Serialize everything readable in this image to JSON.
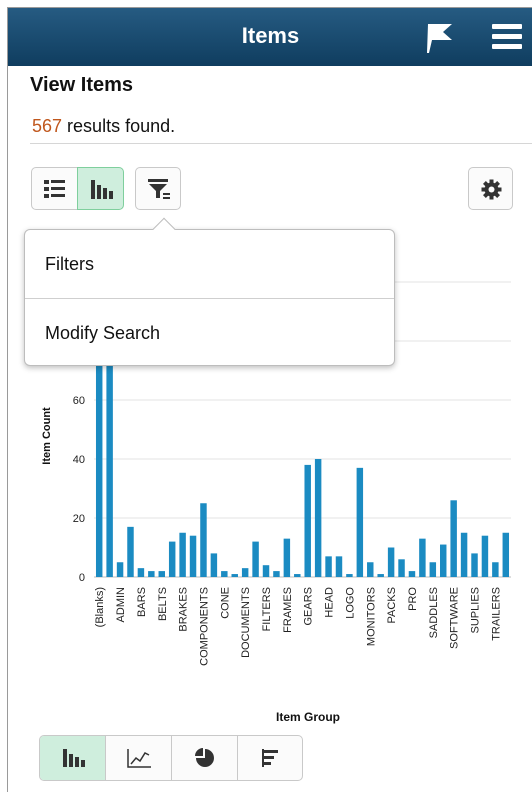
{
  "header": {
    "title": "Items",
    "flag_icon": "flag-icon",
    "menu_icon": "hamburger-menu-icon"
  },
  "page": {
    "title": "View Items",
    "results_count": "567",
    "results_text": " results found."
  },
  "toolbar": {
    "list_view_icon": "list-view-icon",
    "chart_view_icon": "chart-view-icon",
    "filter_icon": "filter-icon",
    "settings_icon": "gear-icon",
    "active_view": "chart"
  },
  "popover": {
    "items": [
      {
        "label": "Filters"
      },
      {
        "label": "Modify Search"
      }
    ]
  },
  "chart_data": {
    "type": "bar",
    "title": "",
    "xlabel": "Item Group",
    "ylabel": "Item Count",
    "yticks": [
      0,
      20,
      40,
      60
    ],
    "ylim": [
      0,
      80
    ],
    "grid": true,
    "color": "#1b8bc2",
    "categories": [
      "(Blanks)",
      "",
      "ADMIN",
      "",
      "BARS",
      "",
      "BELTS",
      "",
      "BRAKES",
      "",
      "COMPONENTS",
      "",
      "CONE",
      "",
      "DOCUMENTS",
      "",
      "FILTERS",
      "",
      "FRAMES",
      "",
      "GEARS",
      "",
      "HEAD",
      "",
      "LOGO",
      "",
      "MONITORS",
      "",
      "PACKS",
      "",
      "PRO",
      "",
      "SADDLES",
      "",
      "SOFTWARE",
      "",
      "SUPLIES",
      "",
      "TRAILERS",
      ""
    ],
    "values": [
      80,
      80,
      5,
      17,
      3,
      2,
      2,
      12,
      15,
      14,
      25,
      8,
      2,
      1,
      3,
      12,
      4,
      2,
      13,
      1,
      38,
      40,
      7,
      7,
      1,
      37,
      5,
      1,
      10,
      6,
      2,
      13,
      5,
      11,
      26,
      15,
      8,
      14,
      5,
      15
    ]
  },
  "chart_types": [
    {
      "name": "bar-chart-icon",
      "active": true
    },
    {
      "name": "line-chart-icon",
      "active": false
    },
    {
      "name": "pie-chart-icon",
      "active": false
    },
    {
      "name": "horizontal-bar-chart-icon",
      "active": false
    }
  ]
}
